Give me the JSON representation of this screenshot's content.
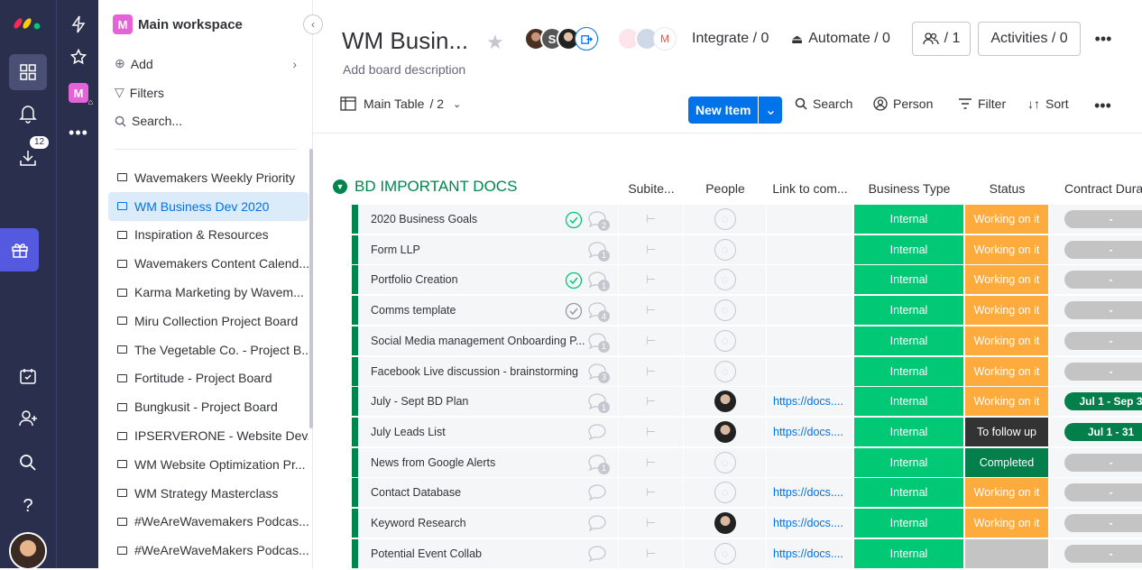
{
  "nav": {
    "notifications_badge": "12"
  },
  "sidebar": {
    "workspace": "Main workspace",
    "add": "Add",
    "filters": "Filters",
    "search": "Search...",
    "boards": [
      {
        "label": "Wavemakers Weekly Priority",
        "selected": false
      },
      {
        "label": "WM Business Dev 2020",
        "selected": true
      },
      {
        "label": "Inspiration & Resources",
        "selected": false
      },
      {
        "label": "Wavemakers Content Calend...",
        "selected": false
      },
      {
        "label": "Karma Marketing by Wavem...",
        "selected": false
      },
      {
        "label": "Miru Collection Project Board",
        "selected": false
      },
      {
        "label": "The Vegetable Co. - Project B...",
        "selected": false
      },
      {
        "label": "Fortitude - Project Board",
        "selected": false
      },
      {
        "label": "Bungkusit - Project Board",
        "selected": false
      },
      {
        "label": "IPSERVERONE - Website Dev...",
        "selected": false
      },
      {
        "label": "WM Website Optimization Pr...",
        "selected": false
      },
      {
        "label": "WM Strategy Masterclass",
        "selected": false
      },
      {
        "label": "#WeAreWavemakers Podcas...",
        "selected": false
      },
      {
        "label": "#WeAreWaveMakers Podcas...",
        "selected": false
      }
    ]
  },
  "header": {
    "title": "WM Busin...",
    "description": "Add board description",
    "avatar_letter": "S",
    "integrate": "Integrate / 0",
    "automate": "Automate / 0",
    "members": "/ 1",
    "activities": "Activities / 0"
  },
  "toolbar": {
    "main_table": "Main Table",
    "views": "/ 2",
    "new_item": "New Item",
    "search": "Search",
    "person": "Person",
    "filter": "Filter",
    "sort": "Sort"
  },
  "group": {
    "title": "BD IMPORTANT DOCS",
    "columns": {
      "subitems": "Subite...",
      "people": "People",
      "link": "Link to com...",
      "business_type": "Business Type",
      "status": "Status",
      "contract": "Contract Dura"
    },
    "rows": [
      {
        "name": "2020 Business Goals",
        "check": "done",
        "updates": "2",
        "person": "",
        "link": "",
        "type": "Internal",
        "status": "Working on it",
        "contract": "-"
      },
      {
        "name": "Form LLP",
        "check": "",
        "updates": "1",
        "person": "",
        "link": "",
        "type": "Internal",
        "status": "Working on it",
        "contract": "-"
      },
      {
        "name": "Portfolio Creation",
        "check": "done",
        "updates": "1",
        "person": "",
        "link": "",
        "type": "Internal",
        "status": "Working on it",
        "contract": "-"
      },
      {
        "name": "Comms template",
        "check": "seen",
        "updates": "4",
        "person": "",
        "link": "",
        "type": "Internal",
        "status": "Working on it",
        "contract": "-"
      },
      {
        "name": "Social Media management Onboarding P...",
        "check": "",
        "updates": "1",
        "person": "",
        "link": "",
        "type": "Internal",
        "status": "Working on it",
        "contract": "-"
      },
      {
        "name": "Facebook Live discussion - brainstorming",
        "check": "",
        "updates": "3",
        "person": "",
        "link": "",
        "type": "Internal",
        "status": "Working on it",
        "contract": "-"
      },
      {
        "name": "July - Sept BD Plan",
        "check": "",
        "updates": "1",
        "person": "photo",
        "link": "https://docs....",
        "type": "Internal",
        "status": "Working on it",
        "contract": "Jul 1 - Sep 3"
      },
      {
        "name": "July Leads List",
        "check": "",
        "updates": "",
        "person": "photo",
        "link": "https://docs....",
        "type": "Internal",
        "status": "To follow up",
        "contract": "Jul 1 - 31"
      },
      {
        "name": "News from Google Alerts",
        "check": "",
        "updates": "1",
        "person": "",
        "link": "",
        "type": "Internal",
        "status": "Completed",
        "contract": "-"
      },
      {
        "name": "Contact Database",
        "check": "",
        "updates": "",
        "person": "",
        "link": "https://docs....",
        "type": "Internal",
        "status": "Working on it",
        "contract": "-"
      },
      {
        "name": "Keyword Research",
        "check": "",
        "updates": "",
        "person": "photo",
        "link": "https://docs....",
        "type": "Internal",
        "status": "Working on it",
        "contract": "-"
      },
      {
        "name": "Potential Event Collab",
        "check": "",
        "updates": "",
        "person": "",
        "link": "https://docs....",
        "type": "Internal",
        "status": "",
        "contract": "-"
      }
    ]
  },
  "colors": {
    "working": "#fdab3d",
    "follow": "#333333",
    "completed": "#037f4c",
    "empty": "#c4c4c4",
    "internal": "#00c875",
    "brand": "#0073ea"
  }
}
